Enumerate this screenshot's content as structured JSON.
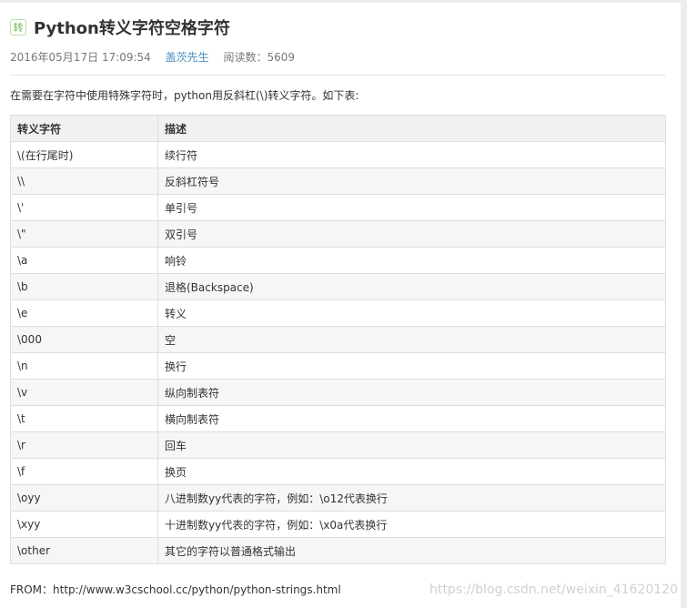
{
  "article": {
    "badge": "转",
    "title": "Python转义字符空格字符",
    "date": "2016年05月17日 17:09:54",
    "author": "盖茨先生",
    "reads": "阅读数：5609",
    "intro": "在需要在字符中使用特殊字符时，python用反斜杠(\\)转义字符。如下表:",
    "from": "FROM：http://www.w3cschool.cc/python/python-strings.html"
  },
  "table": {
    "headers": [
      "转义字符",
      "描述"
    ],
    "rows": [
      [
        "\\(在行尾时)",
        "续行符"
      ],
      [
        "\\\\",
        "反斜杠符号"
      ],
      [
        "\\'",
        "单引号"
      ],
      [
        "\\\"",
        "双引号"
      ],
      [
        "\\a",
        "响铃"
      ],
      [
        "\\b",
        "退格(Backspace)"
      ],
      [
        "\\e",
        "转义"
      ],
      [
        "\\000",
        "空"
      ],
      [
        "\\n",
        "换行"
      ],
      [
        "\\v",
        "纵向制表符"
      ],
      [
        "\\t",
        "横向制表符"
      ],
      [
        "\\r",
        "回车"
      ],
      [
        "\\f",
        "换页"
      ],
      [
        "\\oyy",
        "八进制数yy代表的字符，例如：\\o12代表换行"
      ],
      [
        "\\xyy",
        "十进制数yy代表的字符，例如：\\x0a代表换行"
      ],
      [
        "\\other",
        "其它的字符以普通格式输出"
      ]
    ]
  },
  "watermark": "https://blog.csdn.net/weixin_41620120",
  "colors": {
    "author_link": "#4a8fc2",
    "badge_green": "#67b84a",
    "header_bg": "#f1f1f1",
    "stripe_bg": "#f6f6f6"
  }
}
